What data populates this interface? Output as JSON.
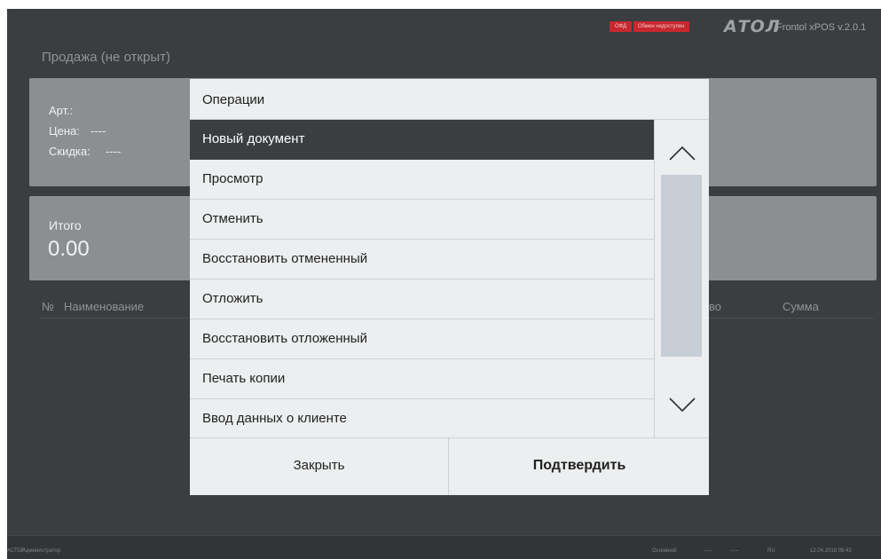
{
  "header": {
    "ofd_badge": "ОФД",
    "exchange_badge": "Обмен недоступен",
    "brand_logo": "АТОЛ",
    "brand_version": "Frontol xPOS v.2.0.1"
  },
  "sale": {
    "status": "Продажа (не открыт)",
    "article_label": "Арт.:",
    "price_label": "Цена:",
    "price_value": "----",
    "discount_label": "Скидка:",
    "discount_value": "----",
    "total_label": "Итого",
    "total_value": "0.00"
  },
  "table": {
    "columns": [
      "№",
      "Наименование",
      "во",
      "Сумма"
    ]
  },
  "footer": {
    "company": "АСТОР",
    "user": "Администратор",
    "mode": "Основной",
    "indicator1": "--:--",
    "indicator2": "--:--",
    "language": "RU",
    "datetime": "12.04.2018 09:43"
  },
  "modal": {
    "title": "Операции",
    "items": [
      "Новый документ",
      "Просмотр",
      "Отменить",
      "Восстановить отмененный",
      "Отложить",
      "Восстановить отложенный",
      "Печать копии",
      "Ввод данных о клиенте"
    ],
    "selected_index": 0,
    "scroll_position": 0,
    "close_label": "Закрыть",
    "confirm_label": "Подтвердить"
  },
  "colors": {
    "background": "#3b3e40",
    "panel": "#8b8f92",
    "selected_item": "#3b3e40",
    "badge_red": "#c7282e",
    "scroll_thumb": "#c7ced5"
  }
}
